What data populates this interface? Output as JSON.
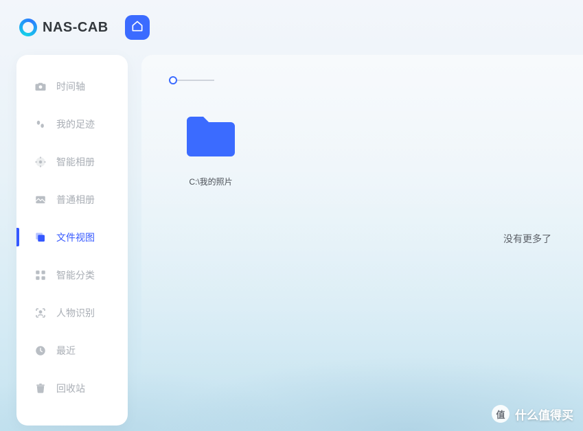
{
  "app": {
    "name": "NAS-CAB"
  },
  "sidebar": {
    "items": [
      {
        "label": "时间轴",
        "icon": "camera-icon",
        "active": false
      },
      {
        "label": "我的足迹",
        "icon": "footprint-icon",
        "active": false
      },
      {
        "label": "智能相册",
        "icon": "smart-album-icon",
        "active": false
      },
      {
        "label": "普通相册",
        "icon": "album-icon",
        "active": false
      },
      {
        "label": "文件视图",
        "icon": "files-icon",
        "active": true
      },
      {
        "label": "智能分类",
        "icon": "category-icon",
        "active": false
      },
      {
        "label": "人物识别",
        "icon": "face-icon",
        "active": false
      },
      {
        "label": "最近",
        "icon": "clock-icon",
        "active": false
      },
      {
        "label": "回收站",
        "icon": "trash-icon",
        "active": false
      }
    ]
  },
  "main": {
    "folders": [
      {
        "name": "C:\\我的照片"
      }
    ],
    "empty_hint": "没有更多了"
  },
  "watermark": {
    "badge": "值",
    "text": "什么值得买"
  }
}
